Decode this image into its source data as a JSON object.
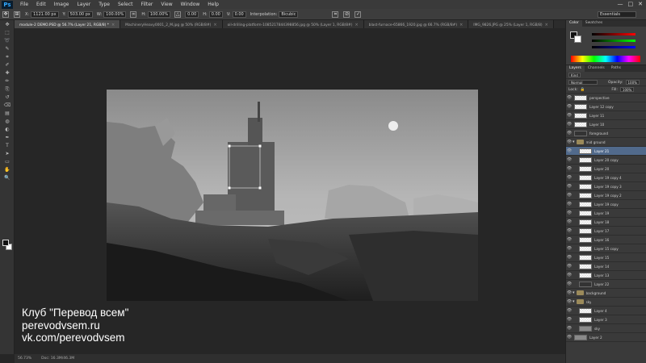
{
  "app": {
    "logo": "Ps",
    "window_controls": [
      "—",
      "□",
      "✕"
    ]
  },
  "menu": [
    "File",
    "Edit",
    "Image",
    "Layer",
    "Type",
    "Select",
    "Filter",
    "View",
    "Window",
    "Help"
  ],
  "options_bar": {
    "x_value": "1121.00 px",
    "y_value": "503.00 px",
    "w_label": "W:",
    "w_value": "100.00%",
    "h_label": "H:",
    "h_value": "100.00%",
    "angle_value": "0.00",
    "h_skew_label": "H:",
    "h_skew_value": "0.00",
    "v_skew_label": "V:",
    "v_skew_value": "0.00",
    "interpolation_label": "Interpolation:",
    "interpolation_value": "Bicubic",
    "workspace": "Essentials"
  },
  "tabs": [
    {
      "label": "module-2 DEMO.PSD @ 56.7% (Layer 21, RGB/8) *",
      "active": true
    },
    {
      "label": "MachineryHeavy0001_2_M.jpg @ 50% (RGB/8#)",
      "active": false
    },
    {
      "label": "oil-drilling-platform-1085217844398856.jpg @ 50% (Layer 1, RGB/8#)",
      "active": false
    },
    {
      "label": "blast-furnace-65866_1920.jpg @ 66.7% (RGB/8#)",
      "active": false
    },
    {
      "label": "IMG_9826.JPG @ 25% (Layer 1, RGB/8)",
      "active": false
    }
  ],
  "tools": [
    "move-icon",
    "marquee-icon",
    "lasso-icon",
    "quick-select-icon",
    "crop-icon",
    "eyedropper-icon",
    "healing-icon",
    "brush-icon",
    "clone-stamp-icon",
    "history-brush-icon",
    "eraser-icon",
    "gradient-icon",
    "blur-icon",
    "dodge-icon",
    "pen-icon",
    "type-icon",
    "path-select-icon",
    "shape-icon",
    "hand-icon",
    "zoom-icon"
  ],
  "watermark": {
    "line1": "Клуб \"Перевод всем\"",
    "line2": "perevodvsem.ru",
    "line3": "vk.com/perevodvsem"
  },
  "status": {
    "zoom": "56.73%",
    "doc": "Doc: 16.3M/46.3M"
  },
  "color_panel": {
    "tabs": [
      "Color",
      "Swatches"
    ],
    "fg": "#111111",
    "bg": "#ffffff"
  },
  "layers_panel": {
    "tabs": [
      "Layers",
      "Channels",
      "Paths"
    ],
    "filter_kind": "Kind",
    "blend_mode": "Normal",
    "opacity_label": "Opacity:",
    "opacity": "100%",
    "lock_label": "Lock:",
    "fill_label": "Fill:",
    "fill": "100%",
    "layers": [
      {
        "name": "perspective",
        "type": "layer",
        "thumb": "trans",
        "indent": 0
      },
      {
        "name": "Layer 12 copy",
        "type": "layer",
        "thumb": "trans",
        "indent": 0
      },
      {
        "name": "Layer 11",
        "type": "layer",
        "thumb": "trans",
        "indent": 0
      },
      {
        "name": "Layer 10",
        "type": "layer",
        "thumb": "trans",
        "indent": 0
      },
      {
        "name": "foreground",
        "type": "layer",
        "thumb": "dark",
        "indent": 0
      },
      {
        "name": "mid ground",
        "type": "group",
        "indent": 0
      },
      {
        "name": "Layer 21",
        "type": "layer",
        "thumb": "trans",
        "indent": 1,
        "selected": true
      },
      {
        "name": "Layer 20 copy",
        "type": "layer",
        "thumb": "trans",
        "indent": 1
      },
      {
        "name": "Layer 20",
        "type": "layer",
        "thumb": "trans",
        "indent": 1
      },
      {
        "name": "Layer 19 copy 4",
        "type": "layer",
        "thumb": "trans",
        "indent": 1
      },
      {
        "name": "Layer 19 copy 3",
        "type": "layer",
        "thumb": "trans",
        "indent": 1
      },
      {
        "name": "Layer 19 copy 2",
        "type": "layer",
        "thumb": "trans",
        "indent": 1
      },
      {
        "name": "Layer 19 copy",
        "type": "layer",
        "thumb": "trans",
        "indent": 1
      },
      {
        "name": "Layer 19",
        "type": "layer",
        "thumb": "trans",
        "indent": 1
      },
      {
        "name": "Layer 18",
        "type": "layer",
        "thumb": "trans",
        "indent": 1
      },
      {
        "name": "Layer 17",
        "type": "layer",
        "thumb": "trans",
        "indent": 1
      },
      {
        "name": "Layer 16",
        "type": "layer",
        "thumb": "trans",
        "indent": 1
      },
      {
        "name": "Layer 15 copy",
        "type": "layer",
        "thumb": "trans",
        "indent": 1
      },
      {
        "name": "Layer 15",
        "type": "layer",
        "thumb": "trans",
        "indent": 1
      },
      {
        "name": "Layer 14",
        "type": "layer",
        "thumb": "trans",
        "indent": 1
      },
      {
        "name": "Layer 13",
        "type": "layer",
        "thumb": "trans",
        "indent": 1
      },
      {
        "name": "Layer 22",
        "type": "layer",
        "thumb": "dark",
        "indent": 1
      },
      {
        "name": "background",
        "type": "group",
        "indent": 0
      },
      {
        "name": "sky",
        "type": "group",
        "indent": 0
      },
      {
        "name": "Layer 4",
        "type": "layer",
        "thumb": "trans",
        "indent": 1
      },
      {
        "name": "Layer 3",
        "type": "layer",
        "thumb": "trans",
        "indent": 1
      },
      {
        "name": "sky",
        "type": "layer",
        "thumb": "grey",
        "indent": 1
      },
      {
        "name": "Layer 2",
        "type": "layer",
        "thumb": "grey",
        "indent": 0
      }
    ]
  }
}
